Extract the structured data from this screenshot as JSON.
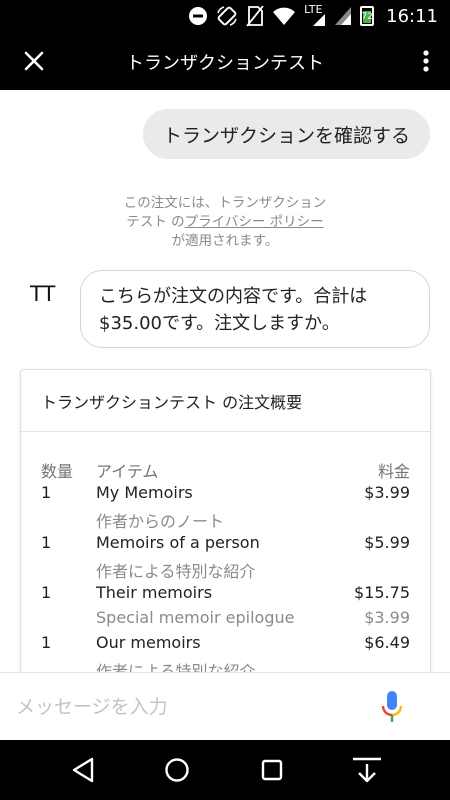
{
  "status_bar": {
    "time": "16:11",
    "network_label": "LTE",
    "battery_level": "72",
    "battery_fraction": 0.72,
    "icons": [
      "do-not-disturb-icon",
      "rotation-icon",
      "no-sim-icon",
      "wifi-icon",
      "lte-signal-icon",
      "cell-signal-icon",
      "battery-icon"
    ]
  },
  "app_bar": {
    "title": "トランザクションテスト",
    "close_icon": "close-icon",
    "menu_icon": "more-vert-icon"
  },
  "chat": {
    "user_message": "トランザクションを確認する",
    "privacy": {
      "line1": "この注文には、トランザクション",
      "line2_prefix": "テスト の",
      "link_text": "プライバシー ポリシー",
      "line3": "が適用されます。"
    },
    "bot_avatar": "TT",
    "bot_message_line1": "こちらが注文の内容です。合計は",
    "bot_message_line2": "$35.00です。注文しますか。"
  },
  "order_card": {
    "title": "トランザクションテスト の注文概要",
    "headers": {
      "qty": "数量",
      "item": "アイテム",
      "price": "料金"
    },
    "items": [
      {
        "qty": "1",
        "name": "My Memoirs",
        "price": "$3.99",
        "sub_name": "作者からのノート",
        "sub_price": ""
      },
      {
        "qty": "1",
        "name": "Memoirs of a person",
        "price": "$5.99",
        "sub_name": "作者による特別な紹介",
        "sub_price": ""
      },
      {
        "qty": "1",
        "name": "Their memoirs",
        "price": "$15.75",
        "sub_name": "Special memoir epilogue",
        "sub_price": "$3.99"
      },
      {
        "qty": "1",
        "name": "Our memoirs",
        "price": "$6.49",
        "sub_name": "作者による特別な紹介",
        "sub_price": ""
      }
    ]
  },
  "input_bar": {
    "placeholder": "メッセージを入力",
    "value": "",
    "mic_icon": "mic-icon",
    "colors": {
      "blue": "#4285f4",
      "red": "#ea4335",
      "yellow": "#fbbc05",
      "green": "#34a853"
    }
  },
  "nav_bar": {
    "icons": [
      "back-icon",
      "home-icon",
      "recents-icon",
      "hide-keyboard-icon"
    ]
  }
}
